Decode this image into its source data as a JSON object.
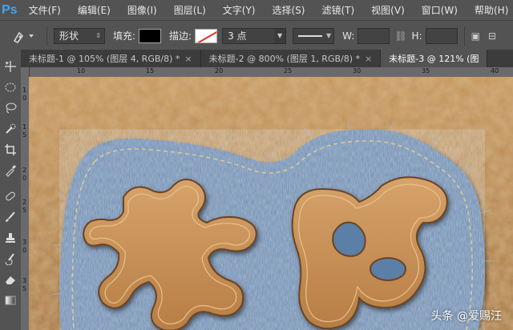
{
  "app": {
    "logo": "Ps"
  },
  "menu": [
    "文件(F)",
    "编辑(E)",
    "图像(I)",
    "图层(L)",
    "文字(Y)",
    "选择(S)",
    "滤镜(T)",
    "视图(V)",
    "窗口(W)",
    "帮助(H)"
  ],
  "options": {
    "mode": "形状",
    "fill_label": "填充:",
    "stroke_label": "描边:",
    "stroke_width": "3 点",
    "w_label": "W:",
    "h_label": "H:",
    "fill_color": "#000000",
    "stroke_color": "#e03020"
  },
  "tabs": [
    {
      "label": "未标题-1 @ 105% (图层 4, RGB/8) *",
      "close": "×"
    },
    {
      "label": "未标题-2 @ 800% (图层 1, RGB/8) *",
      "close": "×"
    },
    {
      "label": "未标题-3 @ 121% (图",
      "close": ""
    }
  ],
  "ruler": {
    "top": [
      "10",
      "15",
      "20",
      "25",
      "30",
      "35",
      "40"
    ],
    "left": [
      "1",
      "0",
      "1",
      "5",
      "2",
      "0",
      "2",
      "5",
      "3",
      "0",
      "3",
      "5"
    ]
  },
  "watermark": "头条 @爱赐汪",
  "colors": {
    "leather": "#b98a4f",
    "denim": "#5b7fa6",
    "stitch": "#d9c89a"
  }
}
